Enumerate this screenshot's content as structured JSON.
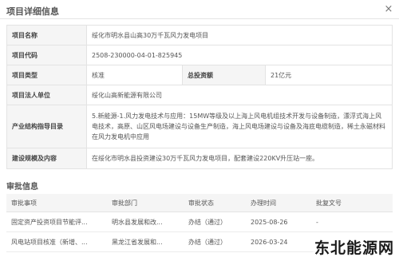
{
  "dialog": {
    "title": "项目详细信息",
    "close_label": "×"
  },
  "info": {
    "name_label": "项目名称",
    "name_value": "绥化市明水县山高30万千瓦风力发电项目",
    "code_label": "项目代码",
    "code_value": "2508-230000-04-01-825945",
    "type_label": "项目类型",
    "type_value": "核准",
    "investment_label": "总投资额",
    "investment_value": "21亿元",
    "legal_label": "项目法人单位",
    "legal_value": "绥化山高新能源有限公司",
    "industry_label": "产业结构指导目录",
    "industry_value": "5.新能源-1.风力发电技术与应用：15MW等级及以上海上风电机组技术开发与设备制造，漂浮式海上风电技术，高原、山区风电场建设与设备生产制造，海上风电场建设与设备及海底电缆制造，稀土永磁材料在风力发电机中应用",
    "scale_label": "建设规模及内容",
    "scale_value": "在绥化市明水县投资建设30万千瓦风力发电项目，配套建设220KV升压站一座。"
  },
  "approval": {
    "section_title": "审批信息",
    "headers": [
      "审批事项",
      "审批部门",
      "审批状态",
      "办理时间",
      "批复文号"
    ],
    "rows": [
      [
        "固定资产投资项目节能评...",
        "明水县发展和改...",
        "办结（通过）",
        "2025-08-26",
        "-"
      ],
      [
        "风电站项目核准（新增、...",
        "黑龙江省发展和...",
        "办结（通过）",
        "2026-03-24",
        ""
      ]
    ]
  },
  "watermark": "东北能源网"
}
